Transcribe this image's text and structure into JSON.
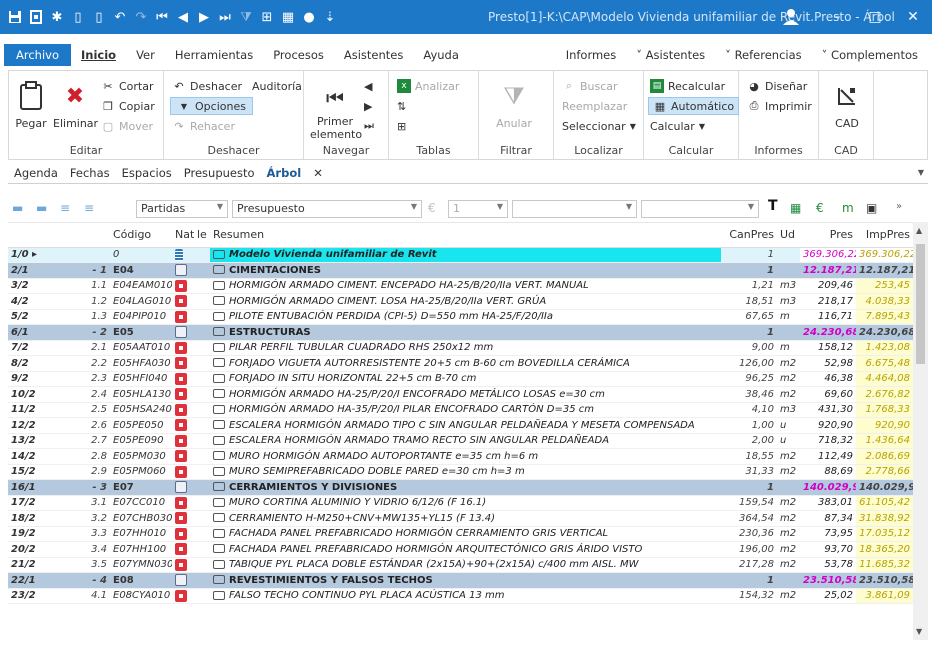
{
  "window": {
    "title": "Presto[1]-K:\\CAP\\Modelo Vivienda unifamiliar de Revit.Presto - Árbol"
  },
  "menu": {
    "file": "Archivo",
    "items": [
      "Inicio",
      "Ver",
      "Herramientas",
      "Procesos",
      "Asistentes",
      "Ayuda"
    ],
    "right": [
      "Informes",
      "Asistentes",
      "Referencias",
      "Complementos"
    ]
  },
  "ribbon": {
    "editar": {
      "label": "Editar",
      "pegar": "Pegar",
      "eliminar": "Eliminar",
      "cortar": "Cortar",
      "copiar": "Copiar",
      "mover": "Mover"
    },
    "deshacer": {
      "label": "Deshacer",
      "deshacer": "Deshacer",
      "auditoria": "Auditoría",
      "opciones": "Opciones",
      "rehacer": "Rehacer"
    },
    "navegar": {
      "label": "Navegar",
      "primer": "Primer",
      "elemento": "elemento"
    },
    "tablas": {
      "label": "Tablas",
      "analizar": "Analizar"
    },
    "filtrar": {
      "label": "Filtrar",
      "anular": "Anular"
    },
    "localizar": {
      "label": "Localizar",
      "buscar": "Buscar",
      "reemplazar": "Reemplazar",
      "seleccionar": "Seleccionar"
    },
    "calcular": {
      "label": "Calcular",
      "recalcular": "Recalcular",
      "automatico": "Automático",
      "calcular": "Calcular"
    },
    "informes": {
      "label": "Informes",
      "disenar": "Diseñar",
      "imprimir": "Imprimir"
    },
    "cad": {
      "label": "CAD",
      "cad": "CAD"
    }
  },
  "tabs": [
    "Agenda",
    "Fechas",
    "Espacios",
    "Presupuesto",
    "Árbol"
  ],
  "toolbar": {
    "partidas": "Partidas",
    "presupuesto": "Presupuesto",
    "num": "1",
    "t": "T"
  },
  "columns": [
    "Código",
    "NatC",
    "le",
    "Resumen",
    "CanPres",
    "Ud",
    "Pres",
    "ImpPres"
  ],
  "rows": [
    {
      "n": "1/0 ▸ -",
      "it": "",
      "code": "0",
      "nat": "root",
      "res": "Modelo Vivienda unifamiliar de Revit",
      "can": "1",
      "ud": "",
      "pres": "369.306,22",
      "imp": "369.306,22",
      "type": "root"
    },
    {
      "n": "2/1",
      "it": "- 1",
      "code": "E04",
      "nat": "ch",
      "res": "CIMENTACIONES",
      "can": "1",
      "ud": "",
      "pres": "12.187,21",
      "imp": "12.187,21",
      "type": "chap"
    },
    {
      "n": "3/2",
      "it": "1.1",
      "code": "E04EAM010",
      "nat": "red",
      "res": "HORMIGÓN ARMADO CIMENT. ENCEPADO HA-25/B/20/IIa VERT. MANUAL",
      "can": "1,21",
      "ud": "m3",
      "pres": "209,46",
      "imp": "253,45",
      "type": ""
    },
    {
      "n": "4/2",
      "it": "1.2",
      "code": "E04LAG010",
      "nat": "red",
      "res": "HORMIGÓN ARMADO CIMENT. LOSA HA-25/B/20/IIa VERT. GRÚA",
      "can": "18,51",
      "ud": "m3",
      "pres": "218,17",
      "imp": "4.038,33",
      "type": ""
    },
    {
      "n": "5/2",
      "it": "1.3",
      "code": "E04PIP010",
      "nat": "red",
      "res": "PILOTE ENTUBACIÓN PERDIDA (CPI-5) D=550 mm HA-25/F/20/IIa",
      "can": "67,65",
      "ud": "m",
      "pres": "116,71",
      "imp": "7.895,43",
      "type": ""
    },
    {
      "n": "6/1",
      "it": "- 2",
      "code": "E05",
      "nat": "ch",
      "res": "ESTRUCTURAS",
      "can": "1",
      "ud": "",
      "pres": "24.230,68",
      "imp": "24.230,68",
      "type": "chap"
    },
    {
      "n": "7/2",
      "it": "2.1",
      "code": "E05AAT010",
      "nat": "red",
      "res": "PILAR PERFIL TUBULAR CUADRADO RHS 250x12 mm",
      "can": "9,00",
      "ud": "m",
      "pres": "158,12",
      "imp": "1.423,08",
      "type": ""
    },
    {
      "n": "8/2",
      "it": "2.2",
      "code": "E05HFA030",
      "nat": "red",
      "res": "FORJADO VIGUETA AUTORRESISTENTE 20+5 cm B-60 cm BOVEDILLA CERÁMICA",
      "can": "126,00",
      "ud": "m2",
      "pres": "52,98",
      "imp": "6.675,48",
      "type": ""
    },
    {
      "n": "9/2",
      "it": "2.3",
      "code": "E05HFI040",
      "nat": "red",
      "res": "FORJADO IN SITU HORIZONTAL 22+5 cm B-70 cm",
      "can": "96,25",
      "ud": "m2",
      "pres": "46,38",
      "imp": "4.464,08",
      "type": ""
    },
    {
      "n": "10/2",
      "it": "2.4",
      "code": "E05HLA130",
      "nat": "red",
      "res": "HORMIGÓN ARMADO HA-25/P/20/I ENCOFRADO METÁLICO LOSAS e=30 cm",
      "can": "38,46",
      "ud": "m2",
      "pres": "69,60",
      "imp": "2.676,82",
      "type": ""
    },
    {
      "n": "11/2",
      "it": "2.5",
      "code": "E05HSA240",
      "nat": "red",
      "res": "HORMIGÓN ARMADO HA-35/P/20/I PILAR ENCOFRADO CARTÓN D=35 cm",
      "can": "4,10",
      "ud": "m3",
      "pres": "431,30",
      "imp": "1.768,33",
      "type": ""
    },
    {
      "n": "12/2",
      "it": "2.6",
      "code": "E05PE050",
      "nat": "red",
      "res": "ESCALERA HORMIGÓN ARMADO TIPO C SIN ANGULAR PELDAÑEADA Y MESETA COMPENSADA",
      "can": "1,00",
      "ud": "u",
      "pres": "920,90",
      "imp": "920,90",
      "type": ""
    },
    {
      "n": "13/2",
      "it": "2.7",
      "code": "E05PE090",
      "nat": "red",
      "res": "ESCALERA HORMIGÓN ARMADO TRAMO RECTO SIN ANGULAR PELDAÑEADA",
      "can": "2,00",
      "ud": "u",
      "pres": "718,32",
      "imp": "1.436,64",
      "type": ""
    },
    {
      "n": "14/2",
      "it": "2.8",
      "code": "E05PM030",
      "nat": "red",
      "res": "MURO HORMIGÓN ARMADO AUTOPORTANTE e=35 cm h=6 m",
      "can": "18,55",
      "ud": "m2",
      "pres": "112,49",
      "imp": "2.086,69",
      "type": ""
    },
    {
      "n": "15/2",
      "it": "2.9",
      "code": "E05PM060",
      "nat": "red",
      "res": "MURO SEMIPREFABRICADO DOBLE PARED e=30 cm h=3 m",
      "can": "31,33",
      "ud": "m2",
      "pres": "88,69",
      "imp": "2.778,66",
      "type": ""
    },
    {
      "n": "16/1",
      "it": "- 3",
      "code": "E07",
      "nat": "ch",
      "res": "CERRAMIENTOS Y DIVISIONES",
      "can": "1",
      "ud": "",
      "pres": "140.029,98",
      "imp": "140.029,98",
      "type": "chap"
    },
    {
      "n": "17/2",
      "it": "3.1",
      "code": "E07CC010",
      "nat": "red",
      "res": "MURO CORTINA ALUMINIO Y VIDRIO 6/12/6 (F 16.1)",
      "can": "159,54",
      "ud": "m2",
      "pres": "383,01",
      "imp": "61.105,42",
      "type": ""
    },
    {
      "n": "18/2",
      "it": "3.2",
      "code": "E07CHB030",
      "nat": "red",
      "res": "CERRAMIENTO H-M250+CNV+MW135+YL15 (F 13.4)",
      "can": "364,54",
      "ud": "m2",
      "pres": "87,34",
      "imp": "31.838,92",
      "type": ""
    },
    {
      "n": "19/2",
      "it": "3.3",
      "code": "E07HH010",
      "nat": "red",
      "res": "FACHADA PANEL PREFABRICADO HORMIGÓN CERRAMIENTO GRIS VERTICAL",
      "can": "230,36",
      "ud": "m2",
      "pres": "73,95",
      "imp": "17.035,12",
      "type": ""
    },
    {
      "n": "20/2",
      "it": "3.4",
      "code": "E07HH100",
      "nat": "red",
      "res": "FACHADA PANEL PREFABRICADO HORMIGÓN ARQUITECTÓNICO GRIS ÁRIDO VISTO",
      "can": "196,00",
      "ud": "m2",
      "pres": "93,70",
      "imp": "18.365,20",
      "type": ""
    },
    {
      "n": "21/2",
      "it": "3.5",
      "code": "E07YMN030",
      "nat": "red",
      "res": "TABIQUE PYL PLACA DOBLE ESTÁNDAR (2x15A)+90+(2x15A) c/400 mm AISL. MW",
      "can": "217,28",
      "ud": "m2",
      "pres": "53,78",
      "imp": "11.685,32",
      "type": ""
    },
    {
      "n": "22/1",
      "it": "- 4",
      "code": "E08",
      "nat": "ch",
      "res": "REVESTIMIENTOS Y FALSOS TECHOS",
      "can": "1",
      "ud": "",
      "pres": "23.510,58",
      "imp": "23.510,58",
      "type": "chap"
    },
    {
      "n": "23/2",
      "it": "4.1",
      "code": "E08CYA010",
      "nat": "red",
      "res": "FALSO TECHO CONTINUO PYL PLACA ACÚSTICA 13 mm",
      "can": "154,32",
      "ud": "m2",
      "pres": "25,02",
      "imp": "3.861,09",
      "type": ""
    }
  ]
}
